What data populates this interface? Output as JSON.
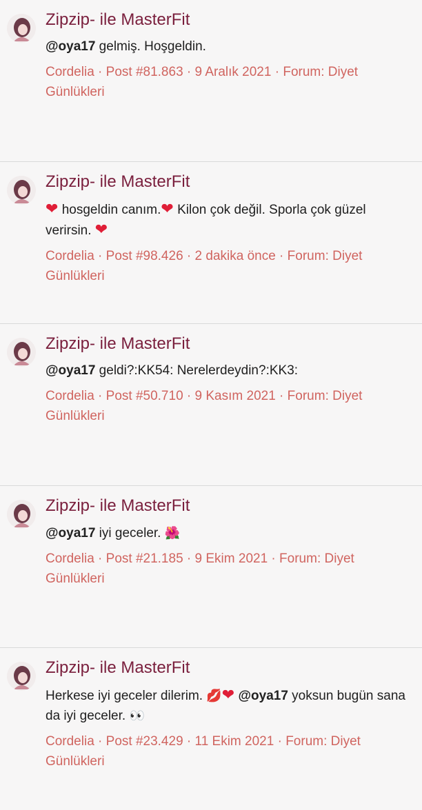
{
  "results": [
    {
      "title": "Zipzip- ile MasterFit",
      "snippet_mention": "@oya17",
      "snippet_text": " gelmiş. Hoşgeldin.",
      "author": "Cordelia",
      "post": "Post #81.863",
      "date": "9 Aralık 2021",
      "forum_label": "Forum: Diyet",
      "forum_label_cont": "Günlükleri"
    },
    {
      "title": "Zipzip- ile MasterFit",
      "snippet_parts": [
        "hosgeldin canım.",
        " Kilon çok değil. Sporla çok güzel verirsin. "
      ],
      "author": "Cordelia",
      "post": "Post #98.426",
      "date": "2 dakika önce",
      "forum_label": "Forum: Diyet",
      "forum_label_cont": "Günlükleri"
    },
    {
      "title": "Zipzip- ile MasterFit",
      "snippet_mention": "@oya17",
      "snippet_text": " geldi?:KK54: Nerelerdeydin?:KK3:",
      "author": "Cordelia",
      "post": "Post #50.710",
      "date": "9 Kasım 2021",
      "forum_label": "Forum: Diyet",
      "forum_label_cont": "Günlükleri"
    },
    {
      "title": "Zipzip- ile MasterFit",
      "snippet_mention": "@oya17",
      "snippet_text": " iyi geceler. ",
      "author": "Cordelia",
      "post": "Post #21.185",
      "date": "9 Ekim 2021",
      "forum_label": "Forum: Diyet",
      "forum_label_cont": "Günlükleri"
    },
    {
      "title": "Zipzip- ile MasterFit",
      "snippet_before": "Herkese iyi geceler dilerim. ",
      "snippet_mention": "@oya17",
      "snippet_after": " yoksun bugün sana da iyi geceler. ",
      "author": "Cordelia",
      "post": "Post #23.429",
      "date": "11 Ekim 2021",
      "forum_label": "Forum: Diyet",
      "forum_label_cont": "Günlükleri"
    }
  ],
  "separator": " · ",
  "colors": {
    "title": "#7a1f3d",
    "meta": "#d0645f",
    "heart": "#e01e37"
  }
}
